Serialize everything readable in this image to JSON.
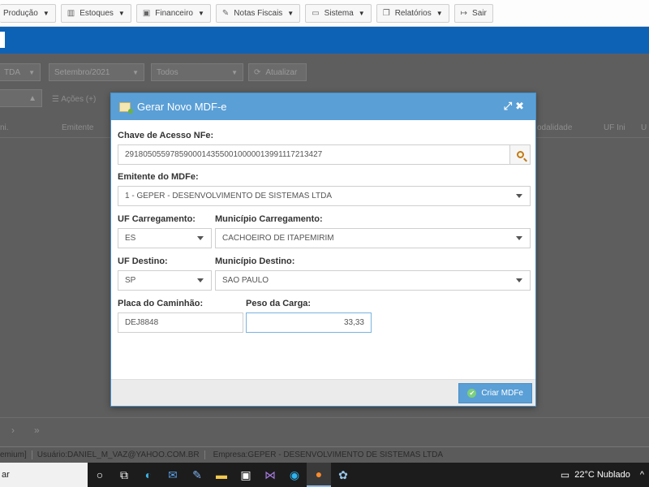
{
  "menu": [
    {
      "label": "Produção",
      "icon": "factory-icon",
      "glyph": "▥"
    },
    {
      "label": "Estoques",
      "icon": "barcode-icon",
      "glyph": "▥"
    },
    {
      "label": "Financeiro",
      "icon": "money-icon",
      "glyph": "▣"
    },
    {
      "label": "Notas Fiscais",
      "icon": "edit-icon",
      "glyph": "✎"
    },
    {
      "label": "Sistema",
      "icon": "laptop-icon",
      "glyph": "▭"
    },
    {
      "label": "Relatórios",
      "icon": "copy-icon",
      "glyph": "❐"
    },
    {
      "label": "Sair",
      "icon": "exit-icon",
      "glyph": "↦"
    }
  ],
  "background": {
    "filter_company": "TDA",
    "filter_month": "Setembro/2021",
    "filter_status": "Todos",
    "refresh_label": "Atualizar",
    "actions_label": "Ações (+)",
    "col_ini": "ni.",
    "col_emitente": "Emitente",
    "col_modalidade": "odalidade",
    "col_uf_ini": "UF Ini",
    "col_uf": "U"
  },
  "modal": {
    "title": "Gerar Novo MDF-e",
    "chave_label": "Chave de Acesso NFe:",
    "chave_value": "29180505597859000143550010000013991117213427",
    "emitente_label": "Emitente do MDFe:",
    "emitente_value": "1 - GEPER - DESENVOLVIMENTO DE SISTEMAS LTDA",
    "uf_carregamento_label": "UF Carregamento:",
    "uf_carregamento_value": "ES",
    "municipio_carregamento_label": "Município Carregamento:",
    "municipio_carregamento_value": "CACHOEIRO DE ITAPEMIRIM",
    "uf_destino_label": "UF Destino:",
    "uf_destino_value": "SP",
    "municipio_destino_label": "Município Destino:",
    "municipio_destino_value": "SAO PAULO",
    "placa_label": "Placa do Caminhão:",
    "placa_value": "DEJ8848",
    "peso_label": "Peso da Carga:",
    "peso_value": "33,33",
    "submit_label": "Criar MDFe"
  },
  "status": {
    "plan": "emium]",
    "user": "Usuário:DANIEL_M_VAZ@YAHOO.COM.BR",
    "company": "Empresa:GEPER - DESENVOLVIMENTO DE SISTEMAS LTDA"
  },
  "taskbar": {
    "search_text": "ar",
    "weather": "22°C  Nublado"
  }
}
